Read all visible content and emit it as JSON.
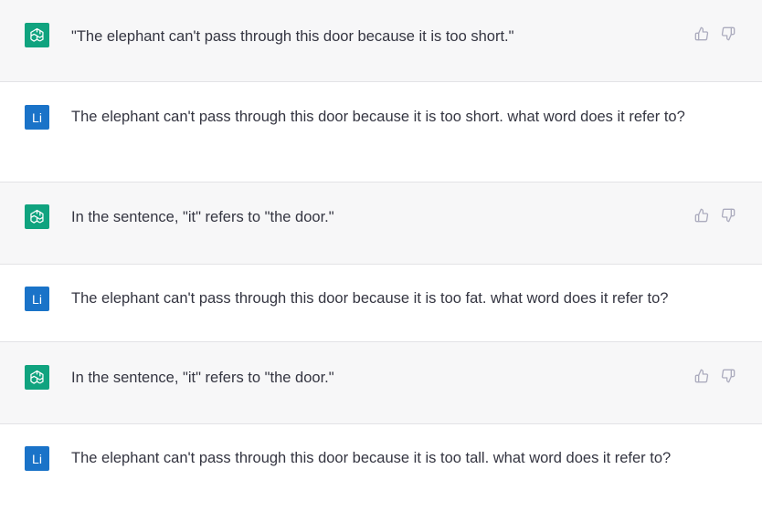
{
  "messages": [
    {
      "role": "assistant",
      "avatar_icon": "openai-logo-icon",
      "text": "\"The elephant can't pass through this door because it is too short.\""
    },
    {
      "role": "user",
      "avatar_label": "Li",
      "text": "The elephant can't pass through this door because it is too short. what word does it refer to?"
    },
    {
      "role": "assistant",
      "avatar_icon": "openai-logo-icon",
      "text": "In the sentence, \"it\" refers to \"the door.\""
    },
    {
      "role": "user",
      "avatar_label": "Li",
      "text": "The elephant can't pass through this door because it is too fat. what word does it refer to?"
    },
    {
      "role": "assistant",
      "avatar_icon": "openai-logo-icon",
      "text": "In the sentence, \"it\" refers to \"the door.\""
    },
    {
      "role": "user",
      "avatar_label": "Li",
      "text": "The elephant can't pass through this door because it is too tall. what word does it refer to?"
    }
  ],
  "feedback_icons": [
    "thumbs-up-icon",
    "thumbs-down-icon"
  ],
  "colors": {
    "assistant_bg": "#f7f7f8",
    "user_bg": "#ffffff",
    "gpt_avatar": "#10a37f",
    "user_avatar": "#1a73c8",
    "text": "#343541",
    "icon": "#acacbe"
  }
}
